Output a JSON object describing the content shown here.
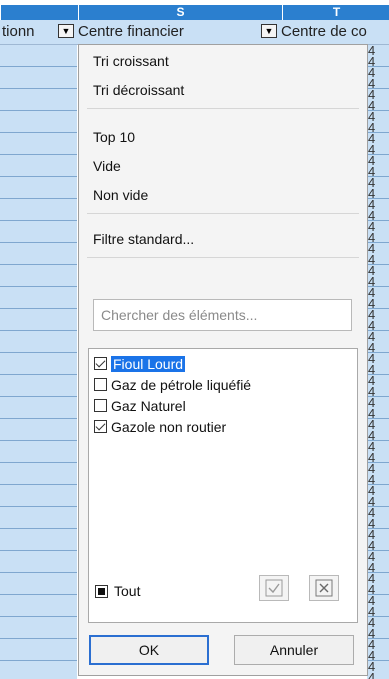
{
  "columns": {
    "S": "S",
    "T": "T"
  },
  "header": {
    "left_partial": "tionn",
    "centre_financier": "Centre financier",
    "centre_de_co": "Centre de co"
  },
  "column_t_cell_digit": "4",
  "filter_menu": {
    "sort_asc": "Tri croissant",
    "sort_desc": "Tri décroissant",
    "top10": "Top 10",
    "empty": "Vide",
    "not_empty": "Non vide",
    "standard_filter": "Filtre standard...",
    "search_placeholder": "Chercher des éléments...",
    "items": [
      {
        "label": "Fioul Lourd",
        "checked": true,
        "selected": true
      },
      {
        "label": "Gaz de pétrole liquéfié",
        "checked": false,
        "selected": false
      },
      {
        "label": "Gaz Naturel",
        "checked": false,
        "selected": false
      },
      {
        "label": "Gazole non routier",
        "checked": true,
        "selected": false
      }
    ],
    "all_label": "Tout",
    "ok_label": "OK",
    "cancel_label": "Annuler"
  },
  "colors": {
    "header_blue": "#2b7fcf",
    "cell_blue": "#c9e0f5",
    "selection": "#1a73e8"
  }
}
